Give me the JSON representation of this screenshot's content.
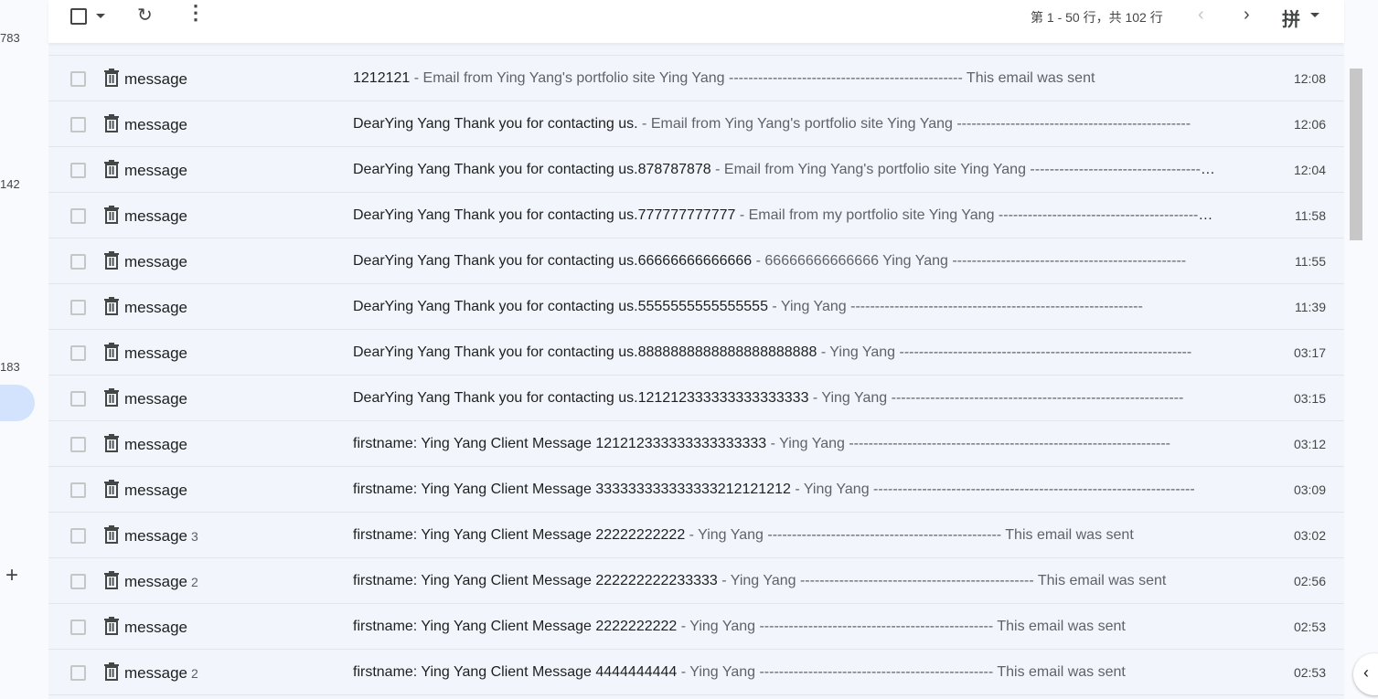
{
  "sidebar": {
    "counts": [
      "783",
      "142",
      "183"
    ],
    "add_icon": "plus-icon"
  },
  "toolbar": {
    "pager": "第 1 - 50 行，共 102 行",
    "ime": "拼",
    "prev": "‹",
    "next": "›",
    "refresh": "↻",
    "more": "⋮"
  },
  "colors": {
    "panel": "#f2f6fc",
    "selected": "#d3e3fd",
    "scrollbar": "#c7c7c7"
  },
  "rows": [
    {
      "sender": "message",
      "count": "",
      "subject": "1212121",
      "snippet": " - Email from Ying Yang's portfolio site Ying Yang ------------------------------------------------ This email was sent",
      "time": "12:08"
    },
    {
      "sender": "message",
      "count": "",
      "subject": "DearYing Yang Thank you for contacting us.",
      "snippet": " - Email from Ying Yang's portfolio site Ying Yang ------------------------------------------------",
      "time": "12:06"
    },
    {
      "sender": "message",
      "count": "",
      "subject": "DearYing Yang Thank you for contacting us.878787878",
      "snippet": " - Email from Ying Yang's portfolio site Ying Yang ------------------------------------------------",
      "time": "12:04"
    },
    {
      "sender": "message",
      "count": "",
      "subject": "DearYing Yang Thank you for contacting us.777777777777",
      "snippet": " - Email from my portfolio site Ying Yang ------------------------------------------------",
      "time": "11:58"
    },
    {
      "sender": "message",
      "count": "",
      "subject": "DearYing Yang Thank you for contacting us.66666666666666",
      "snippet": " - 66666666666666 Ying Yang ------------------------------------------------",
      "time": "11:55"
    },
    {
      "sender": "message",
      "count": "",
      "subject": "DearYing Yang Thank you for contacting us.5555555555555555",
      "snippet": " - Ying Yang ------------------------------------------------------------",
      "time": "11:39"
    },
    {
      "sender": "message",
      "count": "",
      "subject": "DearYing Yang Thank you for contacting us.8888888888888888888888",
      "snippet": " - Ying Yang ------------------------------------------------------------",
      "time": "03:17"
    },
    {
      "sender": "message",
      "count": "",
      "subject": "DearYing Yang Thank you for contacting us.121212333333333333333",
      "snippet": " - Ying Yang ------------------------------------------------------------",
      "time": "03:15"
    },
    {
      "sender": "message",
      "count": "",
      "subject": "firstname: Ying Yang Client Message 121212333333333333333",
      "snippet": " - Ying Yang ------------------------------------------------------------------",
      "time": "03:12"
    },
    {
      "sender": "message",
      "count": "",
      "subject": "firstname: Ying Yang Client Message 333333333333333212121212",
      "snippet": " - Ying Yang ------------------------------------------------------------------",
      "time": "03:09"
    },
    {
      "sender": "message",
      "count": "3",
      "subject": "firstname: Ying Yang Client Message 22222222222",
      "snippet": " - Ying Yang ------------------------------------------------ This email was sent",
      "time": "03:02"
    },
    {
      "sender": "message",
      "count": "2",
      "subject": "firstname: Ying Yang Client Message 222222222233333",
      "snippet": " - Ying Yang ------------------------------------------------ This email was sent",
      "time": "02:56"
    },
    {
      "sender": "message",
      "count": "",
      "subject": "firstname: Ying Yang Client Message 2222222222",
      "snippet": " - Ying Yang ------------------------------------------------ This email was sent",
      "time": "02:53"
    },
    {
      "sender": "message",
      "count": "2",
      "subject": "firstname: Ying Yang Client Message 4444444444",
      "snippet": " - Ying Yang ------------------------------------------------ This email was sent",
      "time": "02:53"
    }
  ]
}
